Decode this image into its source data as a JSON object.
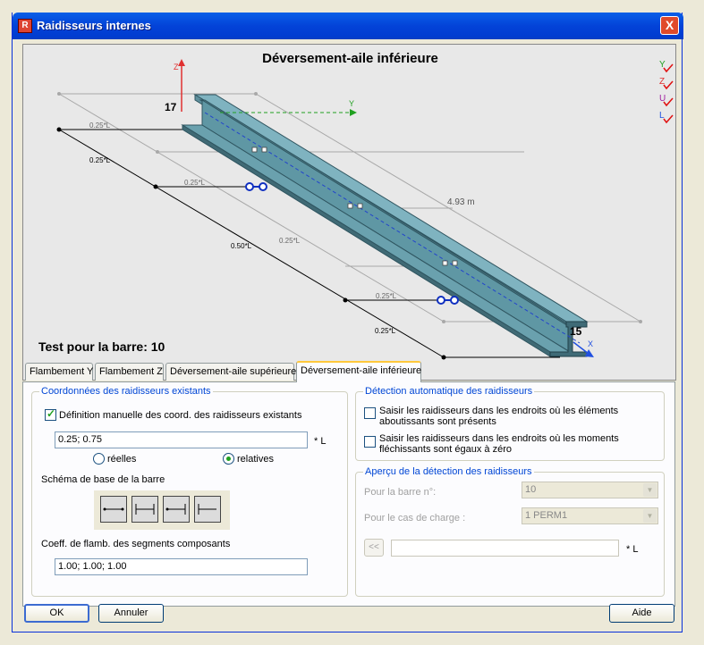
{
  "window": {
    "title": "Raidisseurs internes",
    "close_label": "X",
    "icon_label": "R"
  },
  "preview": {
    "title": "Déversement-aile inférieure",
    "caption": "Test pour la barre: 10",
    "node_start": "17",
    "node_end": "15",
    "length_label": "4.93  m",
    "axis_labels": {
      "z": "Z",
      "y": "Y",
      "x": "X"
    },
    "dim_labels": [
      "0.25*L",
      "0.25*L",
      "0.25*L",
      "0.50*L",
      "0.25*L",
      "0.25*L",
      "0.25*L"
    ],
    "view_icons": [
      "Y",
      "Z",
      "U",
      "L"
    ]
  },
  "tabs": [
    "Flambement Y",
    "Flambement Z",
    "Déversement-aile supérieure",
    "Déversement-aile inférieure"
  ],
  "left": {
    "group_title": "Coordonnées des raidisseurs existants",
    "manual_label": "Définition manuelle des coord. des raidisseurs existants",
    "manual_checked": true,
    "coords_value": "0.25; 0.75",
    "coords_unit": "* L",
    "radio_reelles": "réelles",
    "radio_relatives": "relatives",
    "radio_selected": "relatives",
    "schema_label": "Schéma de base de la barre",
    "coef_label": "Coeff. de flamb. des segments composants",
    "coef_value": "1.00; 1.00; 1.00"
  },
  "right": {
    "detect_title": "Détection automatique des raidisseurs",
    "detect_opt1": "Saisir les raidisseurs dans les endroits où les éléments aboutissants sont présents",
    "detect_opt2": "Saisir les raidisseurs dans les endroits où les moments fléchissants sont égaux à zéro",
    "preview_title": "Aperçu de la détection des raidisseurs",
    "bar_label": "Pour la barre n°:",
    "bar_value": "10",
    "case_label": "Pour le cas de charge :",
    "case_value": "1  PERM1",
    "prev_btn": "<<",
    "unit": "* L"
  },
  "buttons": {
    "ok": "OK",
    "cancel": "Annuler",
    "help": "Aide"
  }
}
